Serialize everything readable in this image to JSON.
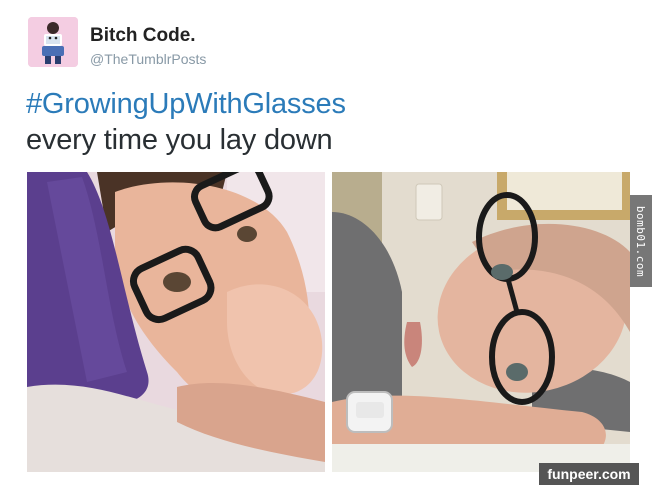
{
  "tweet": {
    "display_name": "Bitch Code.",
    "handle": "@TheTumblrPosts",
    "hashtag": "#GrowingUpWithGlasses",
    "text": "every time you lay down",
    "avatar_icon": "profile-avatar-icon"
  },
  "photos": [
    {
      "name": "photo-left",
      "icon": "selfie-photo"
    },
    {
      "name": "photo-right",
      "icon": "selfie-photo"
    }
  ],
  "watermarks": {
    "side": "bomb01.com",
    "bottom": "funpeer.com"
  },
  "colors": {
    "hashtag": "#2b7bb9",
    "text": "#292f33",
    "handle": "#8899a6",
    "avatar_bg": "#f4cde2"
  }
}
